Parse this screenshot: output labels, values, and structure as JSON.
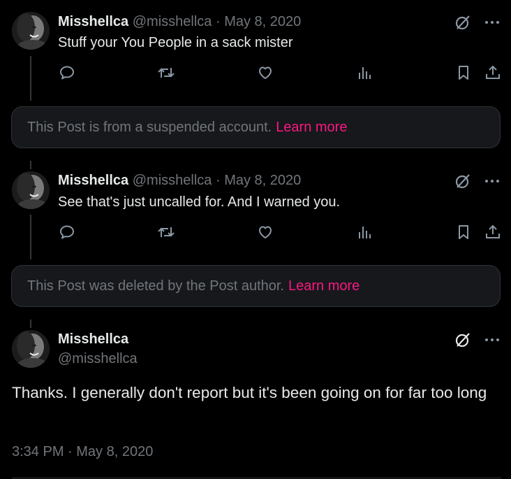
{
  "posts": [
    {
      "display_name": "Misshellca",
      "handle": "@misshellca",
      "separator": "·",
      "date": "May 8, 2020",
      "text": "Stuff your You People in a sack mister"
    },
    {
      "display_name": "Misshellca",
      "handle": "@misshellca",
      "separator": "·",
      "date": "May 8, 2020",
      "text": "See that's just uncalled for. And I warned you."
    }
  ],
  "notices": [
    {
      "text": "This Post is from a suspended account.",
      "link": "Learn more"
    },
    {
      "text": "This Post was deleted by the Post author.",
      "link": "Learn more"
    }
  ],
  "main_post": {
    "display_name": "Misshellca",
    "handle": "@misshellca",
    "text": "Thanks.  I generally don't report but it's been going on for far too long",
    "timestamp": "3:34 PM · May 8, 2020"
  },
  "icons": {
    "top": [
      "grok-icon",
      "more-icon"
    ],
    "actions": [
      "reply-icon",
      "repost-icon",
      "like-icon",
      "views-icon",
      "bookmark-icon",
      "share-icon"
    ]
  },
  "colors": {
    "background": "#000000",
    "text": "#e7e9ea",
    "secondary": "#71767b",
    "link": "#f91880",
    "notice_bg": "#16181c",
    "border": "#2f3336"
  }
}
